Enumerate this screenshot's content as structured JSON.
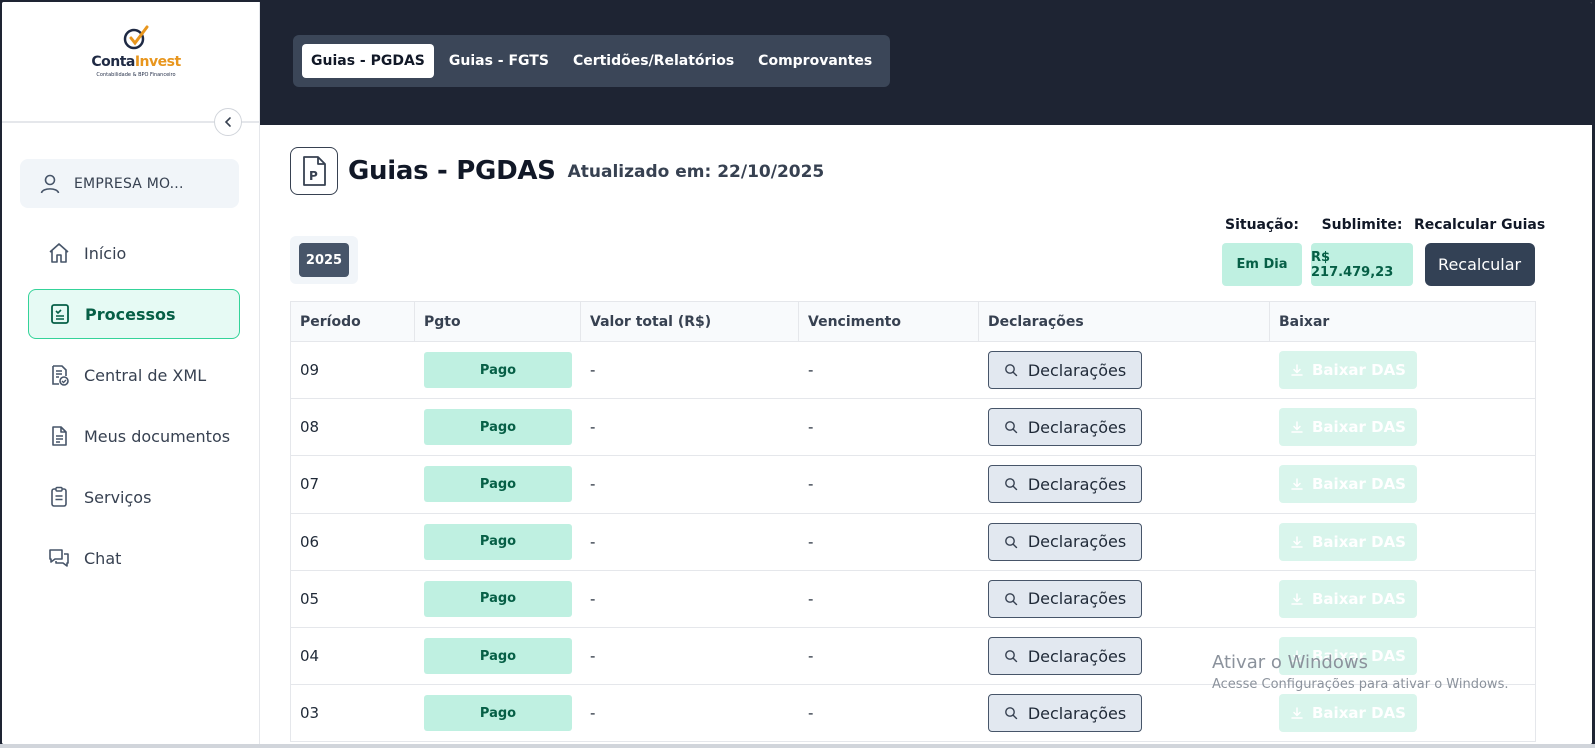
{
  "brand": {
    "name_part1": "Conta",
    "name_part2": "Invest",
    "tagline": "Contabilidade & BPO Financeiro"
  },
  "company": {
    "label": "EMPRESA MO..."
  },
  "sidebar": {
    "items": [
      {
        "label": "Início",
        "icon": "home-icon"
      },
      {
        "label": "Processos",
        "icon": "clipboard-list-icon",
        "active": true
      },
      {
        "label": "Central de XML",
        "icon": "file-check-icon"
      },
      {
        "label": "Meus documentos",
        "icon": "document-icon"
      },
      {
        "label": "Serviços",
        "icon": "clipboard-icon"
      },
      {
        "label": "Chat",
        "icon": "chat-icon"
      }
    ]
  },
  "tabs": [
    {
      "label": "Guias - PGDAS",
      "active": true
    },
    {
      "label": "Guias - FGTS"
    },
    {
      "label": "Certidões/Relatórios"
    },
    {
      "label": "Comprovantes"
    }
  ],
  "page": {
    "title": "Guias - PGDAS",
    "updated": "Atualizado em: 22/10/2025",
    "year": "2025"
  },
  "status": {
    "situacao_label": "Situação:",
    "situacao_value": "Em Dia",
    "sublimite_label": "Sublimite:",
    "sublimite_value": "R$ 217.479,23",
    "recalc_label": "Recalcular Guias",
    "recalc_button": "Recalcular"
  },
  "table": {
    "headers": [
      "Período",
      "Pgto",
      "Valor total (R$)",
      "Vencimento",
      "Declarações",
      "Baixar"
    ],
    "rows": [
      {
        "periodo": "09",
        "pgto": "Pago",
        "valor": "-",
        "vencimento": "-",
        "decl": "Declarações",
        "baixar": "Baixar DAS"
      },
      {
        "periodo": "08",
        "pgto": "Pago",
        "valor": "-",
        "vencimento": "-",
        "decl": "Declarações",
        "baixar": "Baixar DAS"
      },
      {
        "periodo": "07",
        "pgto": "Pago",
        "valor": "-",
        "vencimento": "-",
        "decl": "Declarações",
        "baixar": "Baixar DAS"
      },
      {
        "periodo": "06",
        "pgto": "Pago",
        "valor": "-",
        "vencimento": "-",
        "decl": "Declarações",
        "baixar": "Baixar DAS"
      },
      {
        "periodo": "05",
        "pgto": "Pago",
        "valor": "-",
        "vencimento": "-",
        "decl": "Declarações",
        "baixar": "Baixar DAS"
      },
      {
        "periodo": "04",
        "pgto": "Pago",
        "valor": "-",
        "vencimento": "-",
        "decl": "Declarações",
        "baixar": "Baixar DAS"
      },
      {
        "periodo": "03",
        "pgto": "Pago",
        "valor": "-",
        "vencimento": "-",
        "decl": "Declarações",
        "baixar": "Baixar DAS"
      }
    ]
  },
  "watermark": {
    "line1": "Ativar o Windows",
    "line2": "Acesse Configurações para ativar o Windows."
  },
  "colors": {
    "header_bg": "#1e2433",
    "accent_green": "#34d399",
    "badge_bg": "#bff0e1",
    "dark_button": "#334155"
  }
}
